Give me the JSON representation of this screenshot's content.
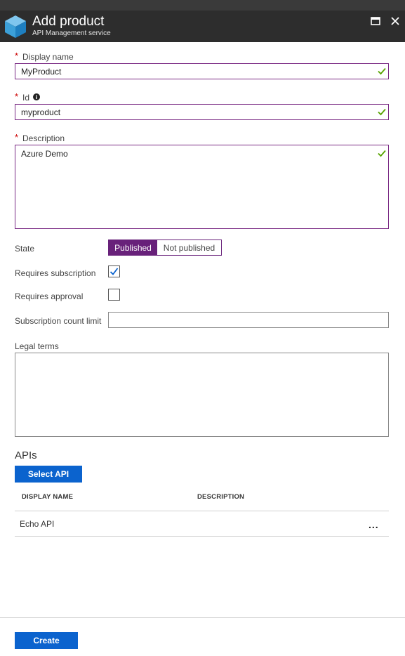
{
  "header": {
    "title": "Add product",
    "subtitle": "API Management service",
    "maximize_icon": "maximize-icon",
    "close_icon": "close-icon"
  },
  "form": {
    "display_name": {
      "label": "Display name",
      "required": true,
      "value": "MyProduct",
      "valid": true
    },
    "id": {
      "label": "Id",
      "required": true,
      "value": "myproduct",
      "valid": true,
      "info_icon": "info-icon"
    },
    "description": {
      "label": "Description",
      "required": true,
      "value": "Azure Demo",
      "valid": true
    },
    "state": {
      "label": "State",
      "options": [
        "Published",
        "Not published"
      ],
      "selected": "Published"
    },
    "requires_subscription": {
      "label": "Requires subscription",
      "checked": true
    },
    "requires_approval": {
      "label": "Requires approval",
      "checked": false
    },
    "subscription_count_limit": {
      "label": "Subscription count limit",
      "value": ""
    },
    "legal_terms": {
      "label": "Legal terms",
      "value": ""
    }
  },
  "apis": {
    "title": "APIs",
    "select_button": "Select API",
    "columns": [
      "DISPLAY NAME",
      "DESCRIPTION"
    ],
    "rows": [
      {
        "display_name": "Echo API",
        "description": ""
      }
    ],
    "row_menu": "..."
  },
  "footer": {
    "create_button": "Create"
  },
  "colors": {
    "header_bg": "#2d2d2d",
    "accent_purple": "#68217a",
    "primary_blue": "#0b63ce",
    "valid_green": "#57a300",
    "required_red": "#cc0000"
  }
}
